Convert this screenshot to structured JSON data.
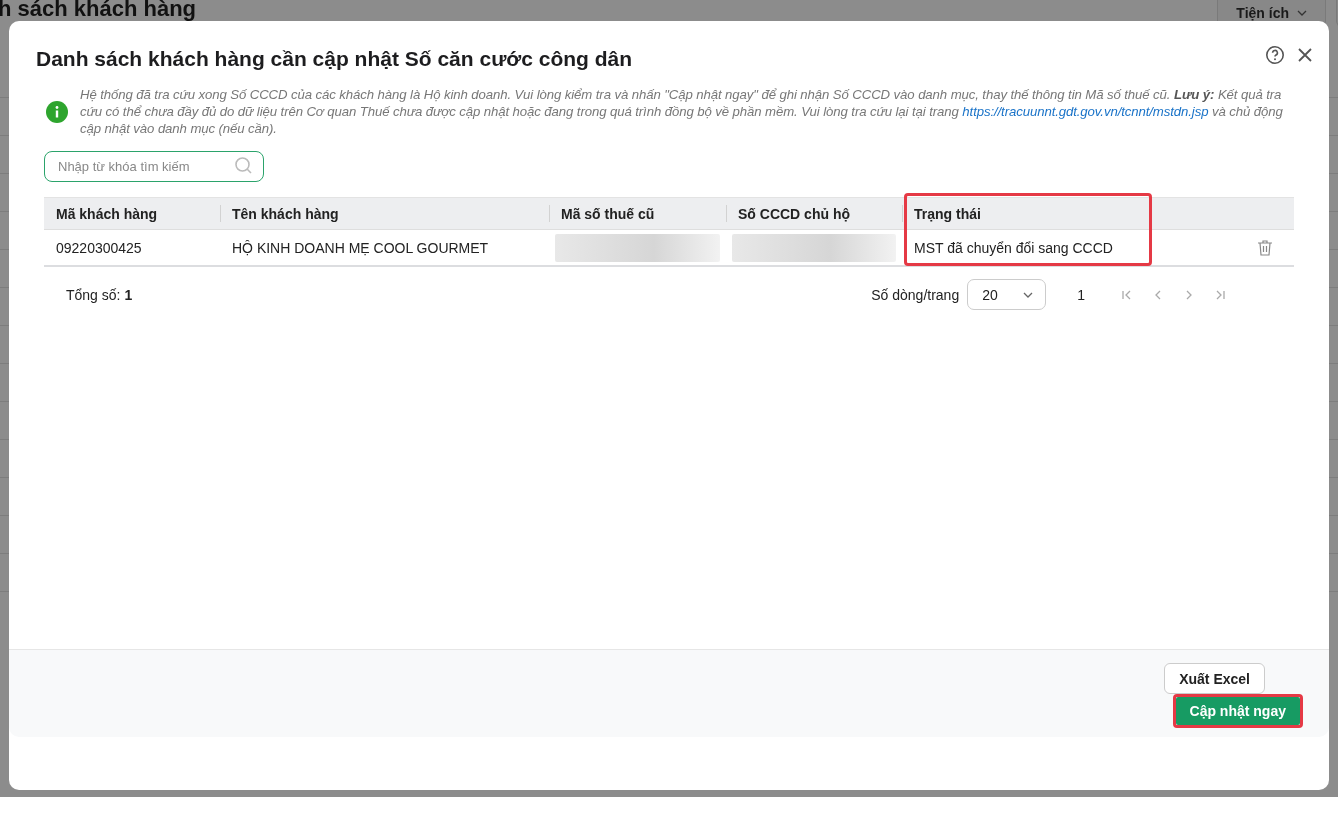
{
  "background_page": {
    "title": "h sách khách hàng",
    "buttons": [
      {
        "label": "Tiện ích",
        "kind": "dropdown"
      },
      {
        "kind": "plain"
      }
    ]
  },
  "dialog": {
    "title": "Danh sách khách hàng cần cập nhật Số căn cước công dân",
    "info": {
      "text_before": "Hệ thống đã tra cứu xong Số CCCD của các khách hàng là Hộ kinh doanh. Vui lòng kiểm tra và nhấn \"Cập nhật ngay\" để ghi nhận Số CCCD vào danh mục, thay thế thông tin Mã số thuế cũ. **Lưu ý:** Kết quả tra cứu có thể chưa đầy đủ do dữ liệu trên Cơ quan Thuế chưa được cập nhật hoặc đang trong quá trình đồng bộ về phần mềm. Vui lòng tra cứu lại tại trang ",
      "link": "https://tracuunnt.gdt.gov.vn/tcnnt/mstdn.jsp",
      "text_after": " và chủ động cập nhật vào danh mục (nếu cần)."
    },
    "search": {
      "placeholder": "Nhập từ khóa tìm kiếm"
    },
    "table": {
      "columns": [
        {
          "label": "Mã khách hàng",
          "highlighted": false
        },
        {
          "label": "Tên khách hàng",
          "highlighted": false
        },
        {
          "label": "Mã số thuế cũ",
          "highlighted": false
        },
        {
          "label": "Số CCCD chủ hộ",
          "highlighted": false
        },
        {
          "label": "Trạng thái",
          "highlighted": true
        }
      ],
      "rows": [
        {
          "cells": [
            {
              "kind": "text",
              "text": "09220300425"
            },
            {
              "kind": "text",
              "text": "HỘ KINH DOANH MẸ COOL GOURMET"
            },
            {
              "kind": "redacted"
            },
            {
              "kind": "redacted"
            },
            {
              "kind": "text",
              "text": "MST đã chuyển đổi sang CCCD"
            }
          ]
        }
      ]
    },
    "pagination": {
      "total_label": "Tổng số:",
      "total": "1",
      "page_size_label": "Số dòng/trang",
      "page_size": "20",
      "page": "1"
    },
    "buttons": [
      {
        "label": "Xuất Excel",
        "kind": "secondary",
        "highlighted": false
      },
      {
        "label": "Cập nhật ngay",
        "kind": "primary",
        "highlighted": true
      }
    ]
  }
}
